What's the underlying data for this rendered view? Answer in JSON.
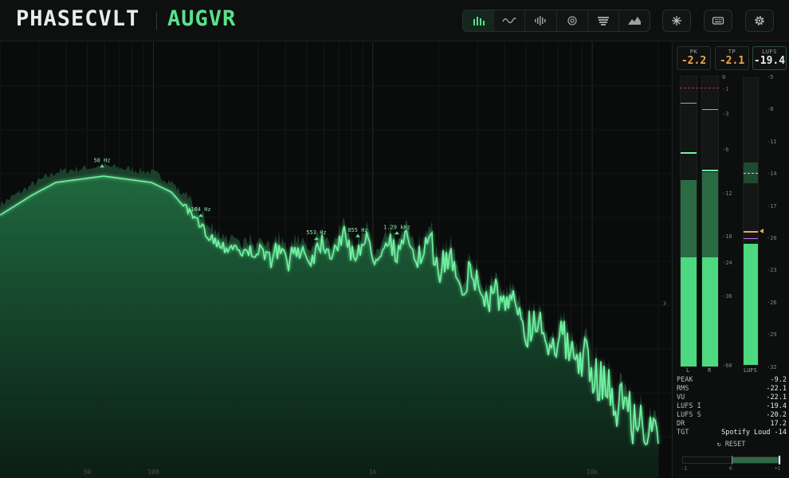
{
  "brand": {
    "company": "PHASECVLT",
    "product": "AUGVR"
  },
  "toolbar": {
    "modes": [
      {
        "icon": "spectrum-bars-icon",
        "active": true
      },
      {
        "icon": "waveform-icon",
        "active": false
      },
      {
        "icon": "oscilloscope-icon",
        "active": false
      },
      {
        "icon": "target-icon",
        "active": false
      },
      {
        "icon": "waterfall-icon",
        "active": false
      },
      {
        "icon": "mountain-icon",
        "active": false
      }
    ],
    "tools": [
      "freeze-icon",
      "keyboard-icon",
      "gear-icon"
    ]
  },
  "spectrum": {
    "peak_labels": [
      "58 Hz",
      "164 Hz",
      "553 Hz",
      "855 Hz",
      "1.29 kHz"
    ],
    "freq_ticks": [
      "50",
      "100",
      "1k",
      "10k"
    ],
    "accent": "#57e389"
  },
  "meters": {
    "readouts": {
      "pk": {
        "label": "PK",
        "value": "-2.2"
      },
      "tp": {
        "label": "TP",
        "value": "-2.1"
      },
      "lufs": {
        "label": "LUFS",
        "value": "-19.4"
      }
    },
    "channel_labels": [
      "L",
      "R",
      "LUFS"
    ],
    "db_scale": [
      "0",
      "-1",
      "-3",
      "-6",
      "-12",
      "-18",
      "-24",
      "-36",
      "-60"
    ],
    "lufs_scale": [
      "-5",
      "-8",
      "-11",
      "-14",
      "-17",
      "-20",
      "-23",
      "-26",
      "-29",
      "-32"
    ],
    "stats": [
      {
        "label": "PEAK",
        "value": "-9.2"
      },
      {
        "label": "RMS",
        "value": "-22.1"
      },
      {
        "label": "VU",
        "value": "-22.1"
      },
      {
        "label": "LUFS I",
        "value": "-19.4"
      },
      {
        "label": "LUFS S",
        "value": "-20.2"
      },
      {
        "label": "DR",
        "value": "17.2"
      },
      {
        "label": "TGT",
        "value": "Spotify Loud -14"
      }
    ],
    "reset_label": "↻ RESET",
    "balance_scale": [
      "-1",
      "0",
      "+1"
    ]
  }
}
